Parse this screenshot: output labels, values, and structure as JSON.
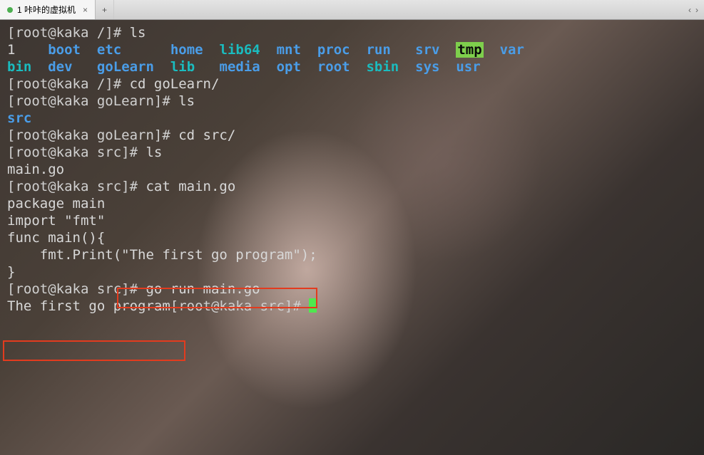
{
  "tab": {
    "title": "1 咔咔的虚拟机",
    "close": "×",
    "new": "+",
    "left": "‹",
    "right": "›"
  },
  "l1": {
    "prompt": "[root@kaka /]# ",
    "cmd": "ls"
  },
  "ls_root": {
    "c0": "1",
    "c1": "boot",
    "c2": "etc",
    "c3": "home",
    "c4": "lib64",
    "c5": "mnt",
    "c6": "proc",
    "c7": "run",
    "c8": "srv",
    "c9": "tmp",
    "c10": "var",
    "d0": "bin",
    "d1": "dev",
    "d2": "goLearn",
    "d3": "lib",
    "d4": "media",
    "d5": "opt",
    "d6": "root",
    "d7": "sbin",
    "d8": "sys",
    "d9": "usr"
  },
  "l2": {
    "prompt": "[root@kaka /]# ",
    "cmd": "cd goLearn/"
  },
  "l3": {
    "prompt": "[root@kaka goLearn]# ",
    "cmd": "ls"
  },
  "l3out": "src",
  "l4": {
    "prompt": "[root@kaka goLearn]# ",
    "cmd": "cd src/"
  },
  "l5": {
    "prompt": "[root@kaka src]# ",
    "cmd": "ls"
  },
  "l5out": "main.go",
  "l6": {
    "prompt": "[root@kaka src]# ",
    "cmd": "cat main.go"
  },
  "code": {
    "a": "package main",
    "b": "",
    "c": "import \"fmt\"",
    "d": "",
    "e": "func main(){",
    "f": "    fmt.Print(\"The first go program\");",
    "g": "}"
  },
  "l7": {
    "prompt": "[root@kaka src]# ",
    "cmd": "go run main.go"
  },
  "out": "The first go program",
  "l8": {
    "prompt": "[root@kaka src]# "
  }
}
